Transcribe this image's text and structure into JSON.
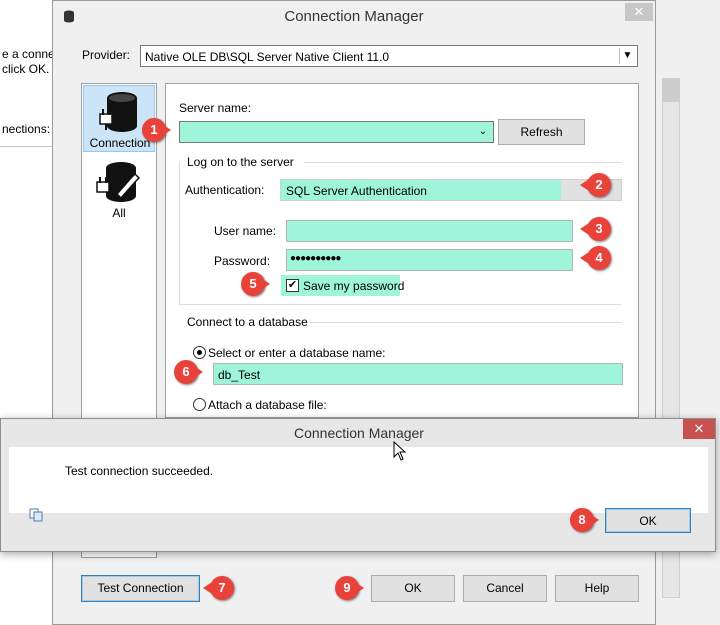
{
  "background": {
    "left_text_1": "e a connec",
    "left_text_2": "click OK.",
    "left_text_3": "nections:"
  },
  "dialog": {
    "title": "Connection Manager",
    "close": "✕",
    "provider_label": "Provider:",
    "provider_value": "Native OLE DB\\SQL Server Native Client 11.0",
    "nav": [
      {
        "label": "Connection",
        "icon": "database-plug-icon",
        "selected": true
      },
      {
        "label": "All",
        "icon": "database-wrench-icon",
        "selected": false
      }
    ],
    "server_name_label": "Server name:",
    "server_name_value": "",
    "refresh_label": "Refresh",
    "logon_group": "Log on to the server",
    "auth_label": "Authentication:",
    "auth_value": "SQL Server Authentication",
    "user_label": "User name:",
    "user_value": "",
    "password_label": "Password:",
    "password_value": "●●●●●●●●●●",
    "save_password_label": "Save my password",
    "save_password_checked": true,
    "db_group": "Connect to a database",
    "select_db_label": "Select or enter a database name:",
    "db_value": "db_Test",
    "attach_label": "Attach a database file:",
    "test_connection_label": "Test Connection",
    "ok_label": "OK",
    "cancel_label": "Cancel",
    "help_label": "Help"
  },
  "popup": {
    "title": "Connection Manager",
    "close": "✕",
    "message": "Test connection succeeded.",
    "ok_label": "OK",
    "copy_icon": "copy-icon"
  },
  "annotations": [
    "1",
    "2",
    "3",
    "4",
    "5",
    "6",
    "7",
    "8",
    "9"
  ],
  "colors": {
    "highlight": "#9ef5d9",
    "badge": "#e8423a",
    "selection": "#cce4f7"
  }
}
